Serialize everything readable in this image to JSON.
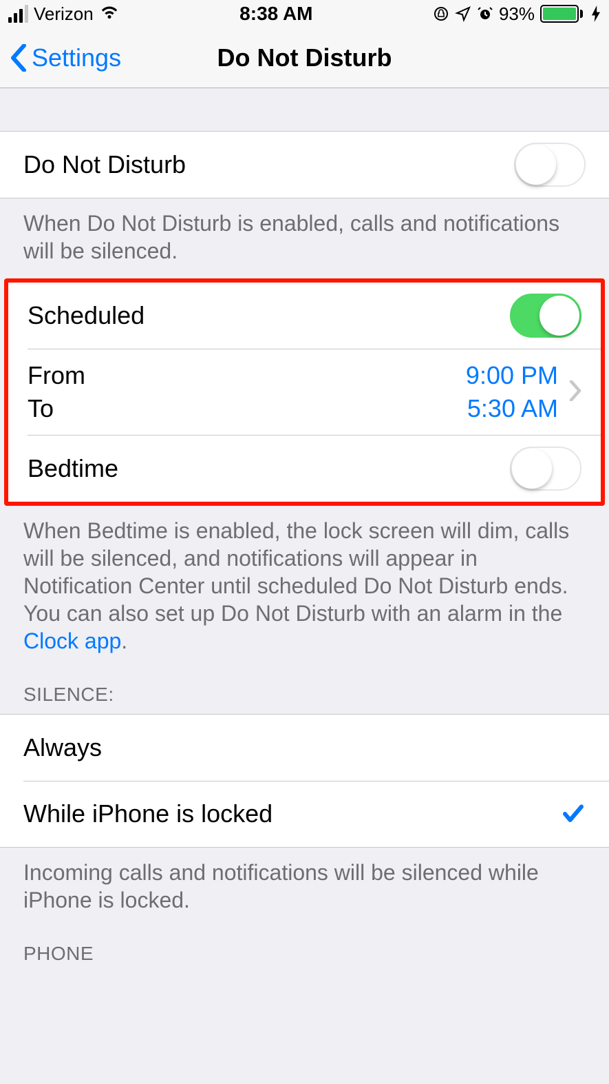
{
  "status_bar": {
    "carrier": "Verizon",
    "time": "8:38 AM",
    "battery_percent": "93%"
  },
  "nav": {
    "back_label": "Settings",
    "title": "Do Not Disturb"
  },
  "dnd": {
    "row_label": "Do Not Disturb",
    "switch_on": false,
    "footer": "When Do Not Disturb is enabled, calls and notifications will be silenced."
  },
  "scheduled": {
    "row_label": "Scheduled",
    "switch_on": true,
    "from_label": "From",
    "to_label": "To",
    "from_value": "9:00 PM",
    "to_value": "5:30 AM"
  },
  "bedtime": {
    "row_label": "Bedtime",
    "switch_on": false,
    "footer_pre": "When Bedtime is enabled, the lock screen will dim, calls will be silenced, and notifications will appear in Notification Center until scheduled Do Not Disturb ends. You can also set up Do Not Disturb with an alarm in the ",
    "footer_link": "Clock app",
    "footer_post": "."
  },
  "silence": {
    "header": "SILENCE:",
    "option_always": "Always",
    "option_locked": "While iPhone is locked",
    "selected": "locked",
    "footer": "Incoming calls and notifications will be silenced while iPhone is locked."
  },
  "phone": {
    "header": "PHONE"
  }
}
